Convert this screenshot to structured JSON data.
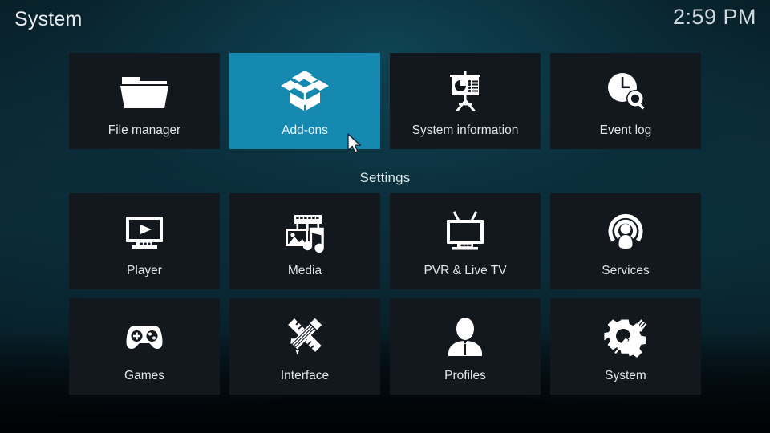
{
  "header": {
    "title": "System",
    "clock": "2:59 PM"
  },
  "top_row": {
    "items": [
      {
        "label": "File manager",
        "icon": "folder-icon",
        "focused": false
      },
      {
        "label": "Add-ons",
        "icon": "open-box-icon",
        "focused": true
      },
      {
        "label": "System information",
        "icon": "presentation-board-icon",
        "focused": false
      },
      {
        "label": "Event log",
        "icon": "clock-search-icon",
        "focused": false
      }
    ]
  },
  "settings": {
    "heading": "Settings",
    "items": [
      {
        "label": "Player",
        "icon": "monitor-play-icon",
        "focused": false
      },
      {
        "label": "Media",
        "icon": "film-photo-music-icon",
        "focused": false
      },
      {
        "label": "PVR & Live TV",
        "icon": "tv-antenna-icon",
        "focused": false
      },
      {
        "label": "Services",
        "icon": "broadcast-person-icon",
        "focused": false
      },
      {
        "label": "Games",
        "icon": "gamepad-icon",
        "focused": false
      },
      {
        "label": "Interface",
        "icon": "pencil-ruler-icon",
        "focused": false
      },
      {
        "label": "Profiles",
        "icon": "person-icon",
        "focused": false
      },
      {
        "label": "System",
        "icon": "gear-tools-icon",
        "focused": false
      }
    ]
  },
  "cursor": {
    "icon": "mouse-pointer-icon"
  },
  "colors": {
    "focus_highlight": "#1689b0",
    "tile_background": "#13171e",
    "icon_fill": "#ffffff",
    "text_primary": "#dfe6ea"
  }
}
